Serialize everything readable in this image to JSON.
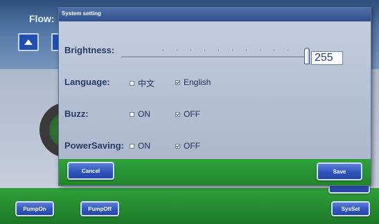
{
  "background": {
    "flow_label": "Flow:",
    "up_icon": "triangle-up-icon",
    "buttons": {
      "pump_on": "PumpOn",
      "pump_off": "PumpOff",
      "sys_set": "SysSet"
    }
  },
  "dialog": {
    "title": "System setting",
    "brightness": {
      "label": "Brightness:",
      "value": "255",
      "level": 255,
      "max": 255
    },
    "language": {
      "label": "Language:",
      "options": [
        {
          "label": "中文",
          "checked": false
        },
        {
          "label": "English",
          "checked": true
        }
      ]
    },
    "buzz": {
      "label": "Buzz:",
      "options": [
        {
          "label": "ON",
          "checked": false
        },
        {
          "label": "OFF",
          "checked": true
        }
      ]
    },
    "power_saving": {
      "label": "PowerSaving:",
      "options": [
        {
          "label": "ON",
          "checked": false
        },
        {
          "label": "OFF",
          "checked": true
        }
      ]
    },
    "footer": {
      "cancel": "Cancel",
      "save": "Save"
    }
  },
  "colors": {
    "dialog_title_bar": "#2f4f8c",
    "footer_green": "#21862c",
    "button_blue": "#2f56bd"
  }
}
